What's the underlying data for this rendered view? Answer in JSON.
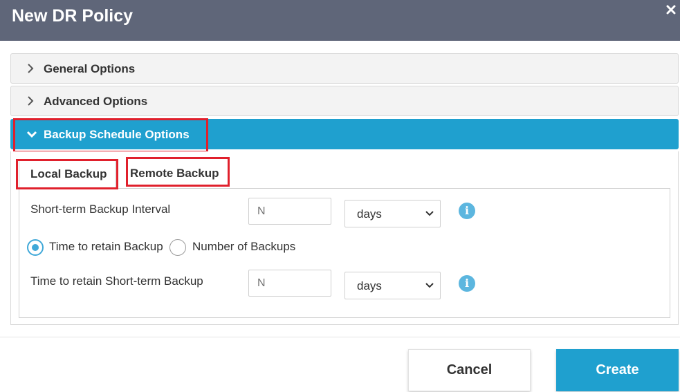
{
  "dialog": {
    "title": "New DR Policy",
    "close_icon": "close-icon"
  },
  "panels": {
    "general": {
      "label": "General Options",
      "expanded": false
    },
    "advanced": {
      "label": "Advanced Options",
      "expanded": false
    },
    "backup_schedule": {
      "label": "Backup Schedule Options",
      "expanded": true
    }
  },
  "tabs": {
    "local": {
      "label": "Local Backup",
      "active": true
    },
    "remote": {
      "label": "Remote Backup",
      "active": false
    }
  },
  "form": {
    "short_term_interval": {
      "label": "Short-term Backup Interval",
      "placeholder": "N",
      "unit": "days"
    },
    "retention_mode": {
      "option_time": "Time to retain Backup",
      "option_count": "Number of Backups",
      "selected": "option_time"
    },
    "retain_short_term": {
      "label": "Time to retain Short-term Backup",
      "placeholder": "N",
      "unit": "days"
    },
    "info_icon": "info-icon"
  },
  "footer": {
    "cancel_label": "Cancel",
    "create_label": "Create"
  },
  "colors": {
    "titlebar": "#5f6679",
    "accent": "#1fa0cf",
    "highlight": "#e0202c"
  }
}
